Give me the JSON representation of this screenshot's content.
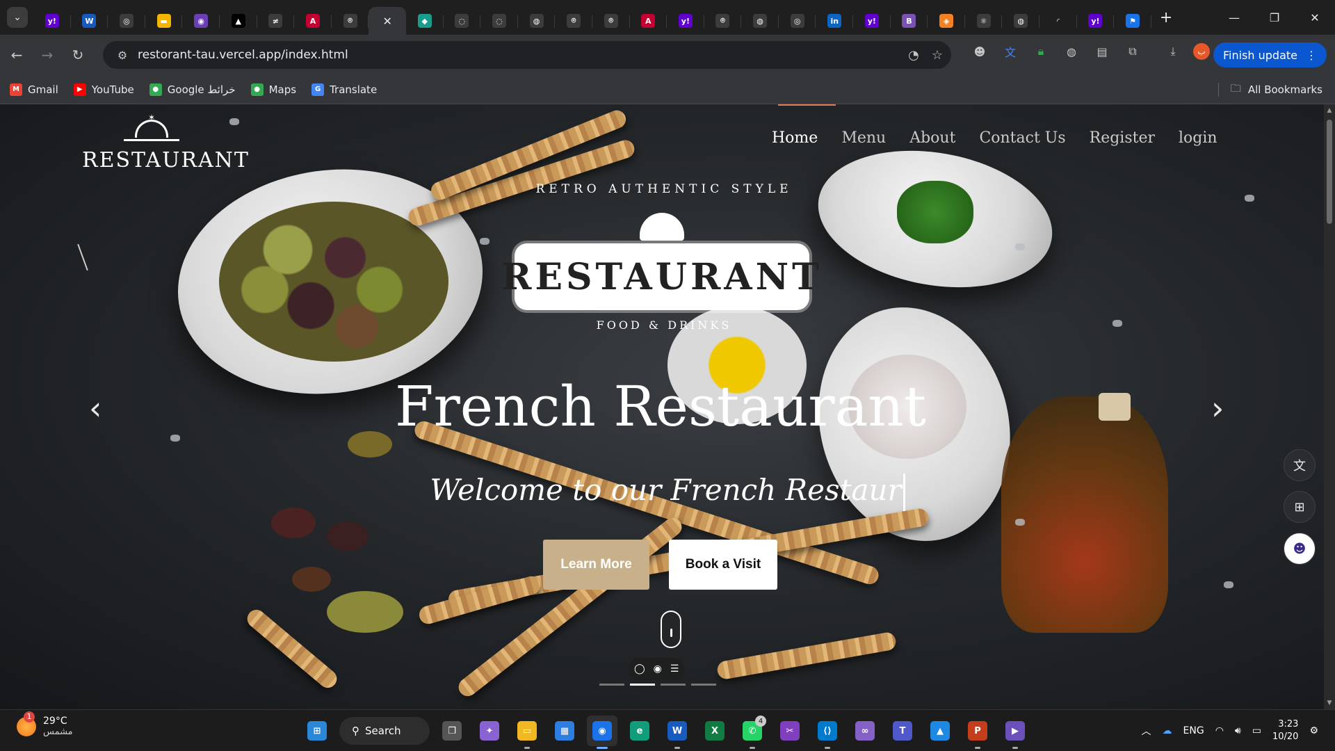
{
  "browser": {
    "tab_search_icon": "chevron-down-icon",
    "tabs": [
      {
        "icon": "yahoo-icon",
        "color": "#6001d2",
        "glyph": "y!"
      },
      {
        "icon": "word-icon",
        "color": "#185abd",
        "glyph": "W"
      },
      {
        "icon": "openai-icon",
        "color": "#3c3c3c",
        "glyph": "◎"
      },
      {
        "icon": "slides-icon",
        "color": "#f4b400",
        "glyph": "▬"
      },
      {
        "icon": "app-icon",
        "color": "#6a3fb5",
        "glyph": "◉"
      },
      {
        "icon": "vercel-icon",
        "color": "#000000",
        "glyph": "▲"
      },
      {
        "icon": "app-icon",
        "color": "#3c3c3c",
        "glyph": "≠"
      },
      {
        "icon": "angular-icon",
        "color": "#c3002f",
        "glyph": "A"
      },
      {
        "icon": "github-icon",
        "color": "#3c3c3c",
        "glyph": "⌾"
      },
      {
        "icon": "close-icon",
        "color": "",
        "glyph": "✕",
        "active": true
      },
      {
        "icon": "diamond-icon",
        "color": "#1a9c8c",
        "glyph": "◆"
      },
      {
        "icon": "app-icon",
        "color": "#3c3c3c",
        "glyph": "◌"
      },
      {
        "icon": "app-icon",
        "color": "#3c3c3c",
        "glyph": "◌"
      },
      {
        "icon": "globe-icon",
        "color": "#3c3c3c",
        "glyph": "◍"
      },
      {
        "icon": "github-icon",
        "color": "#3c3c3c",
        "glyph": "⌾"
      },
      {
        "icon": "github-icon",
        "color": "#3c3c3c",
        "glyph": "⌾"
      },
      {
        "icon": "angular-icon",
        "color": "#c3002f",
        "glyph": "A"
      },
      {
        "icon": "yahoo-icon",
        "color": "#6001d2",
        "glyph": "y!"
      },
      {
        "icon": "github-icon",
        "color": "#3c3c3c",
        "glyph": "⌾"
      },
      {
        "icon": "globe-icon",
        "color": "#3c3c3c",
        "glyph": "◍"
      },
      {
        "icon": "app-icon",
        "color": "#3c3c3c",
        "glyph": "◎"
      },
      {
        "icon": "linkedin-icon",
        "color": "#0a66c2",
        "glyph": "in"
      },
      {
        "icon": "yahoo-icon",
        "color": "#6001d2",
        "glyph": "y!"
      },
      {
        "icon": "bootstrap-icon",
        "color": "#7952b3",
        "glyph": "B"
      },
      {
        "icon": "app-icon",
        "color": "#f48024",
        "glyph": "◈"
      },
      {
        "icon": "react-icon",
        "color": "#3c3c3c",
        "glyph": "⚛"
      },
      {
        "icon": "globe-icon",
        "color": "#3c3c3c",
        "glyph": "◍"
      },
      {
        "icon": "loading-icon",
        "color": "",
        "glyph": "◜"
      },
      {
        "icon": "yahoo-icon",
        "color": "#6001d2",
        "glyph": "y!"
      },
      {
        "icon": "flag-icon",
        "color": "#1a73e8",
        "glyph": "⚑"
      }
    ],
    "url": "restorant-tau.vercel.app/index.html",
    "finish_update": "Finish update",
    "profile_letter": "ب",
    "bookmarks": [
      {
        "label": "Gmail",
        "icon": "gmail-icon",
        "color": "#ea4335",
        "glyph": "M"
      },
      {
        "label": "YouTube",
        "icon": "youtube-icon",
        "color": "#ff0000",
        "glyph": "▶"
      },
      {
        "label": "Google خرائط",
        "icon": "maps-icon",
        "color": "#34a853",
        "glyph": "●"
      },
      {
        "label": "Maps",
        "icon": "maps-icon",
        "color": "#34a853",
        "glyph": "●"
      },
      {
        "label": "Translate",
        "icon": "translate-icon",
        "color": "#4285f4",
        "glyph": "G"
      }
    ],
    "all_bookmarks": "All Bookmarks"
  },
  "site": {
    "brand": "RESTAURANT",
    "nav": [
      {
        "label": "Home",
        "active": true
      },
      {
        "label": "Menu"
      },
      {
        "label": "About"
      },
      {
        "label": "Contact Us"
      },
      {
        "label": "Register"
      },
      {
        "label": "login"
      }
    ],
    "emblem": {
      "top": "RETRO AUTHENTIC STYLE",
      "word": "RESTAURANT",
      "sub": "FOOD & DRINKS"
    },
    "hero_title": "French Restaurant",
    "hero_subtitle": "Welcome to our French Restaur",
    "learn_more": "Learn More",
    "book_visit": "Book a Visit",
    "carousel_dots": [
      false,
      true,
      false,
      false
    ]
  },
  "taskbar": {
    "temperature": "29°C",
    "condition": "مشمس",
    "weather_badge": "1",
    "search": "Search",
    "apps": [
      {
        "name": "start-icon",
        "color": "#2b88d8",
        "glyph": "⊞"
      },
      {
        "name": "search-box"
      },
      {
        "name": "task-view-icon",
        "color": "#555555",
        "glyph": "❐"
      },
      {
        "name": "copilot-icon",
        "color": "#8a63d2",
        "glyph": "✦"
      },
      {
        "name": "file-explorer-icon",
        "color": "#f2b824",
        "glyph": "▭",
        "run": true
      },
      {
        "name": "store-icon",
        "color": "#2e7de1",
        "glyph": "▦"
      },
      {
        "name": "chrome-icon",
        "color": "#1a73e8",
        "glyph": "◉",
        "active": true
      },
      {
        "name": "edge-icon",
        "color": "#0f9d7a",
        "glyph": "e"
      },
      {
        "name": "word-icon",
        "color": "#185abd",
        "glyph": "W",
        "run": true
      },
      {
        "name": "excel-icon",
        "color": "#107c41",
        "glyph": "X"
      },
      {
        "name": "whatsapp-icon",
        "color": "#25d366",
        "glyph": "✆",
        "run": true,
        "badge": "4"
      },
      {
        "name": "snipping-tool-icon",
        "color": "#7f3fbf",
        "glyph": "✂"
      },
      {
        "name": "vscode-icon",
        "color": "#007acc",
        "glyph": "⟨⟩",
        "run": true
      },
      {
        "name": "visual-studio-icon",
        "color": "#8661c5",
        "glyph": "∞"
      },
      {
        "name": "teams-icon",
        "color": "#5059c9",
        "glyph": "T"
      },
      {
        "name": "paint-icon",
        "color": "#1e88e5",
        "glyph": "▲"
      },
      {
        "name": "powerpoint-icon",
        "color": "#c43e1c",
        "glyph": "P",
        "run": true
      },
      {
        "name": "media-player-icon",
        "color": "#6b4fbb",
        "glyph": "▶",
        "run": true
      }
    ],
    "language": "ENG",
    "time": "3:23",
    "date": "10/20"
  }
}
